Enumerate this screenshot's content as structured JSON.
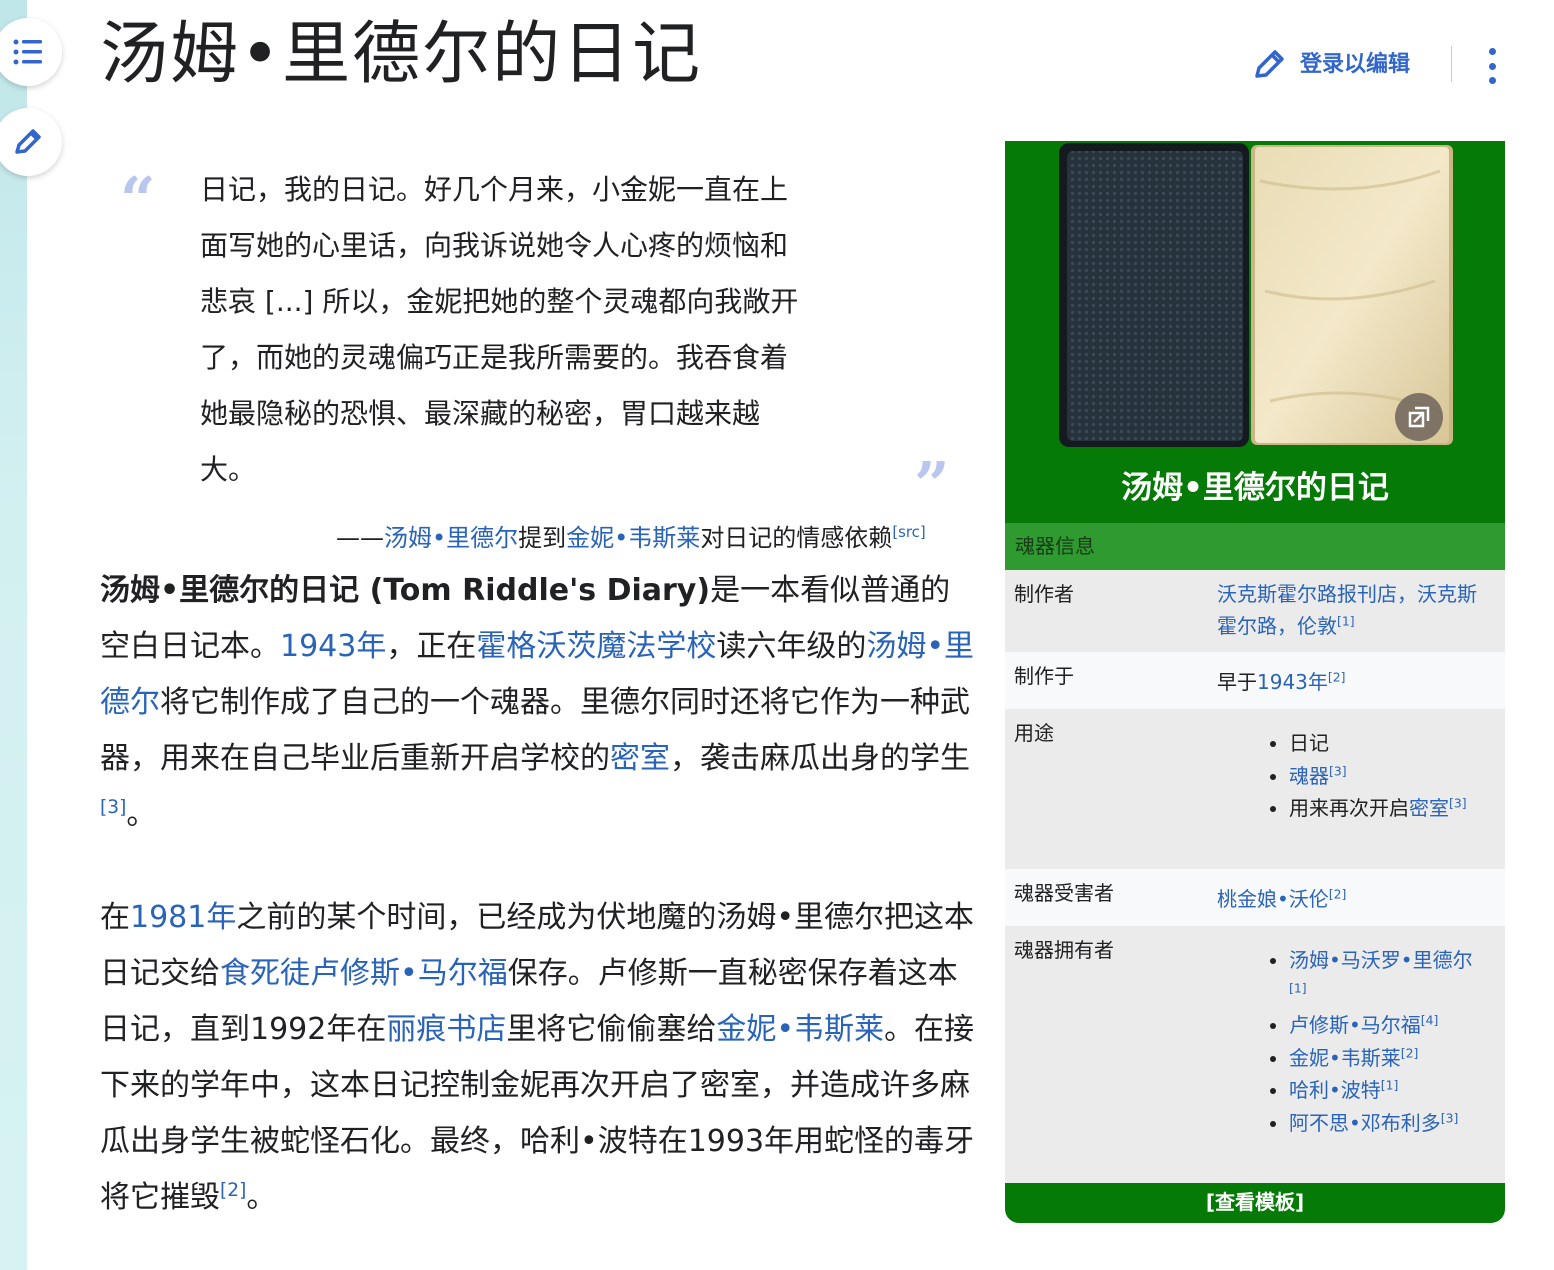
{
  "page": {
    "title": "汤姆•里德尔的日记",
    "login_edit_label": "登录以编辑"
  },
  "quote": {
    "lines": [
      "日记，我的日记。好几个月来，小金妮一直在上",
      "面写她的心里话，向我诉说她令人心疼的烦恼和",
      "悲哀 [...] 所以，金妮把她的整个灵魂都向我敞开",
      "了，而她的灵魂偏巧正是我所需要的。我吞食着",
      "她最隐秘的恐惧、最深藏的秘密，胃口越来越",
      "大。"
    ],
    "attr_dash": "——",
    "attr_link1": "汤姆•里德尔",
    "attr_mid": "提到",
    "attr_link2": "金妮•韦斯莱",
    "attr_tail": "对日记的情感依赖",
    "attr_ref": "[src]"
  },
  "para1": {
    "bold": "汤姆•里德尔的日记 (Tom Riddle's Diary)",
    "t1": "是一本看似普通的空白日记本。",
    "l1": "1943年",
    "t2": "，正在",
    "l2": "霍格沃茨魔法学校",
    "t3": "读六年级的",
    "l3": "汤姆•里德尔",
    "t4": "将它制作成了自己的一个魂器。里德尔同时还将它作为一种武器，用来在自己毕业后重新开启学校的",
    "l4": "密室",
    "t5": "，袭击麻瓜出身的学生",
    "ref": "[3]",
    "t6": "。"
  },
  "para2": {
    "t1": "在",
    "l1": "1981年",
    "t2": "之前的某个时间，已经成为伏地魔的汤姆•里德尔把这本日记交给",
    "l2": "食死徒",
    "l3": "卢修斯•马尔福",
    "t3": "保存。卢修斯一直秘密保存着这本日记，直到1992年在",
    "l4": "丽痕书店",
    "t4": "里将它偷偷塞给",
    "l5": "金妮•韦斯莱",
    "t5": "。在接下来的学年中，这本日记控制金妮再次开启了密室，并造成许多麻瓜出身学生被蛇怪石化。最终，哈利•波特在1993年用蛇怪的毒牙将它摧毁",
    "ref": "[2]",
    "t6": "。"
  },
  "infobox": {
    "title": "汤姆•里德尔的日记",
    "section": "魂器信息",
    "maker_label": "制作者",
    "maker_value": "沃克斯霍尔路报刊店，沃克斯霍尔路，伦敦",
    "maker_ref": "[1]",
    "made_label": "制作于",
    "made_prefix": "早于",
    "made_link": "1943年",
    "made_ref": "[2]",
    "use_label": "用途",
    "uses": [
      {
        "text": "日记",
        "ref": ""
      },
      {
        "text": "魂器",
        "ref": "[3]"
      },
      {
        "text_pre": "用来再次开启",
        "text": "密室",
        "ref": "[3]"
      }
    ],
    "victim_label": "魂器受害者",
    "victim_value": "桃金娘•沃伦",
    "victim_ref": "[2]",
    "owner_label": "魂器拥有者",
    "owners": [
      {
        "text": "汤姆•马沃罗•里德尔",
        "ref": "[1]"
      },
      {
        "text": "卢修斯•马尔福",
        "ref": "[4]"
      },
      {
        "text": "金妮•韦斯莱",
        "ref": "[2]"
      },
      {
        "text": "哈利•波特",
        "ref": "[1]"
      },
      {
        "text": "阿不思•邓布利多",
        "ref": "[3]"
      }
    ],
    "footer": "[查看模板]"
  },
  "colors": {
    "infobox_green": "#067a06",
    "section_green": "#2f9a2f",
    "link_blue": "#3366cc"
  }
}
